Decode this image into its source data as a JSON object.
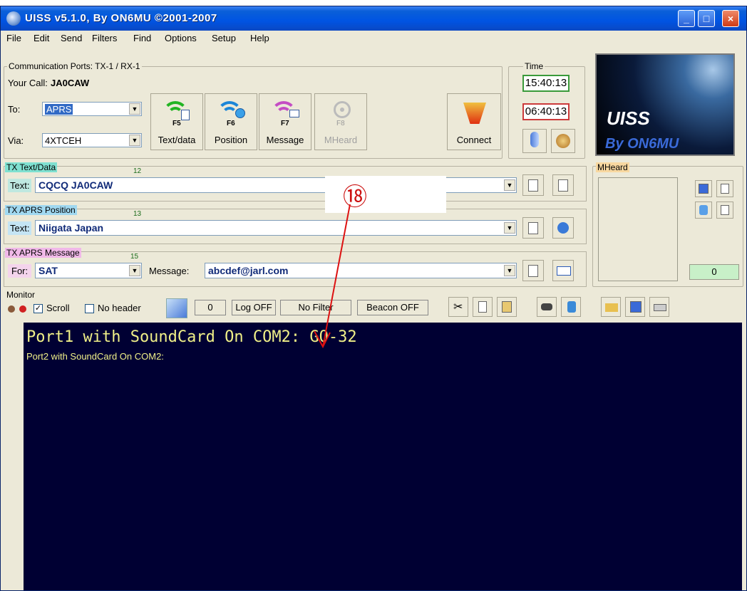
{
  "window": {
    "title": "UISS v5.1.0, By ON6MU ©2001-2007",
    "caption_buttons": {
      "minimize": "_",
      "maximize": "□",
      "close": "×"
    }
  },
  "menu": [
    "File",
    "Edit",
    "Send",
    "Filters",
    "Find",
    "Options",
    "Setup",
    "Help"
  ],
  "comm": {
    "group_label": "Communication Ports: TX-1 / RX-1",
    "your_call_label": "Your Call:",
    "your_call": "JA0CAW",
    "to_label": "To:",
    "to_value": "APRS",
    "via_label": "Via:",
    "via_value": "4XTCEH"
  },
  "buttons": {
    "text_data": {
      "label": "Text/data",
      "key": "F5"
    },
    "position": {
      "label": "Position",
      "key": "F6"
    },
    "message": {
      "label": "Message",
      "key": "F7"
    },
    "mheard": {
      "label": "MHeard",
      "key": "F8"
    },
    "connect": "Connect"
  },
  "time": {
    "label": "Time",
    "utc": "15:40:13",
    "local": "06:40:13"
  },
  "logo": {
    "line1": "UISS",
    "line2": "By ON6MU"
  },
  "tx_text": {
    "label": "TX Text/Data",
    "count": "12",
    "field_label": "Text:",
    "value": "CQCQ  JA0CAW"
  },
  "tx_pos": {
    "label": "TX APRS Position",
    "count": "13",
    "field_label": "Text:",
    "value": "Niigata Japan"
  },
  "tx_msg": {
    "label": "TX APRS Message",
    "count": "15",
    "for_label": "For:",
    "for_value": "SAT",
    "message_label": "Message:",
    "message_value": "abcdef@jarl.com"
  },
  "mheard": {
    "label": "MHeard",
    "count": "0"
  },
  "monitor": {
    "label": "Monitor",
    "scroll": "Scroll",
    "no_header": "No header",
    "counter": "0",
    "log": "Log OFF",
    "filter": "No Filter",
    "beacon": "Beacon OFF",
    "line1": "Port1 with SoundCard On COM2: GO-32",
    "line2": "Port2 with SoundCard On COM2:"
  },
  "annotation": {
    "number": "⑱"
  },
  "colors": {
    "title_bar": "#0054e3",
    "monitor_bg": "#000033",
    "monitor_text": "#f0f088",
    "callout": "#cc1111"
  }
}
